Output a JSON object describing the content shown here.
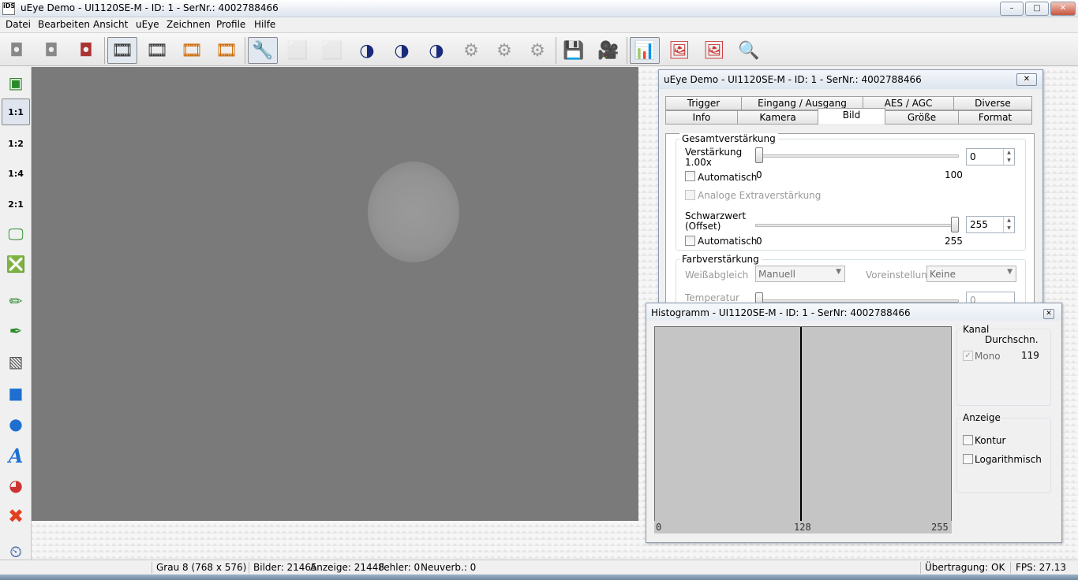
{
  "window": {
    "title": "uEye Demo - UI1120SE-M - ID: 1 - SerNr.: 4002788466",
    "icon_text": "iDS",
    "min": "–",
    "max": "□",
    "close": "✕"
  },
  "menu": [
    "Datei",
    "Bearbeiten",
    "Ansicht",
    "uEye",
    "Zeichnen",
    "Profile",
    "Hilfe"
  ],
  "settings": {
    "title": "uEye Demo - UI1120SE-M - ID: 1 - SerNr.: 4002788466",
    "close": "✕",
    "tabs_row1": [
      "Trigger",
      "Eingang / Ausgang",
      "AES / AGC",
      "Diverse"
    ],
    "tabs_row2": [
      "Info",
      "Kamera",
      "Bild",
      "Größe",
      "Format"
    ],
    "active_tab": "Bild",
    "gain": {
      "group": "Gesamtverstärkung",
      "label1": "Verstärkung",
      "label2": "1.00x",
      "value": "0",
      "min": "0",
      "max": "100",
      "auto": "Automatisch",
      "extra": "Analoge Extraverstärkung"
    },
    "black": {
      "label1": "Schwarzwert",
      "label2": "(Offset)",
      "value": "255",
      "min": "0",
      "max": "255",
      "auto": "Automatisch"
    },
    "color": {
      "group": "Farbverstärkung",
      "wb_label": "Weißabgleich",
      "wb_value": "Manuell",
      "preset_label": "Voreinstellung",
      "preset_value": "Keine",
      "temp_label": "Temperatur",
      "temp_value": "0"
    }
  },
  "histogram": {
    "title": "Histogramm - UI1120SE-M - ID: 1 - SerNr: 4002788466",
    "close": "✕",
    "axis": [
      "0",
      "128",
      "255"
    ],
    "channel_group": "Kanal",
    "avg_header": "Durchschn.",
    "channel": "Mono",
    "channel_avg": "119",
    "display_group": "Anzeige",
    "contour": "Kontur",
    "log": "Logarithmisch"
  },
  "status": {
    "format": "Grau 8 (768 x 576)",
    "frames": "Bilder: 21465",
    "display": "Anzeige: 21448",
    "errors": "Fehler: 0",
    "reconnect": "Neuverb.: 0",
    "transfer": "Übertragung: OK",
    "fps": "FPS: 27.13"
  },
  "zoom": {
    "fit_label": "▣",
    "z11": "1:1",
    "z12": "1:2",
    "z14": "1:4",
    "z21": "2:1"
  },
  "colors": {
    "image_bg": "#7a7a7a",
    "accent": "#2b5fa8"
  }
}
